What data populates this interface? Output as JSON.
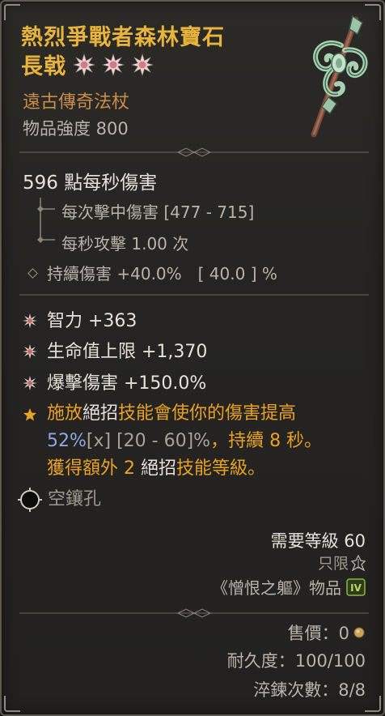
{
  "item": {
    "name_line1": "熱烈爭戰者森林寶石",
    "name_line2": "長戟",
    "greater_affix_icons": [
      "greater-affix-star-icon",
      "greater-affix-star-icon",
      "greater-affix-star-icon"
    ],
    "subtype": "遠古傳奇法杖",
    "item_power": "物品強度 800",
    "weapon_icon": "polearm-weapon-icon"
  },
  "damage": {
    "dps": "596 點每秒傷害",
    "per_hit": "每次擊中傷害 [477 - 715]",
    "attack_speed": "每秒攻擊 1.00 次",
    "dot": "持續傷害 +40.0%　[ 40.0 ] %"
  },
  "affixes": [
    {
      "icon": "affix-burst-icon",
      "text": "智力 +363"
    },
    {
      "icon": "affix-burst-icon",
      "text": "生命值上限 +1,370"
    },
    {
      "icon": "affix-burst-icon",
      "text": "爆擊傷害 +150.0%"
    }
  ],
  "legendary": {
    "icon": "legendary-star-icon",
    "l1_a": "施放",
    "l1_b": "絕招",
    "l1_c": "技能會使你的傷害提高",
    "l2_val": "52%",
    "l2_x": "[x]",
    "l2_range": " [20 - 60]%",
    "l2_rest": "，持續 8 秒。",
    "l3_a": "獲得額外 2 ",
    "l3_b": "絕招",
    "l3_c": "技能等級。"
  },
  "socket": {
    "icon": "empty-socket-icon",
    "label": "空鑲孔"
  },
  "requirements": {
    "level": "需要等級 60",
    "class_only": "只限",
    "class_icon": "druid-class-icon",
    "expansion": "《憎恨之軀》物品",
    "expansion_icon": "vessel-of-hatred-icon"
  },
  "footer": {
    "sell_label": "售價：0",
    "gold_icon": "gold-coin-icon",
    "durability": "耐久度：100/100",
    "temper": "淬鍊次數：8/8"
  },
  "colors": {
    "title": "#e8b43c",
    "subtype": "#c88c4a",
    "legendary_orange": "#e8a323",
    "roll_blue": "#8fa7e0",
    "text_light": "#e6e2da",
    "text_grey": "#b9b4aa"
  }
}
